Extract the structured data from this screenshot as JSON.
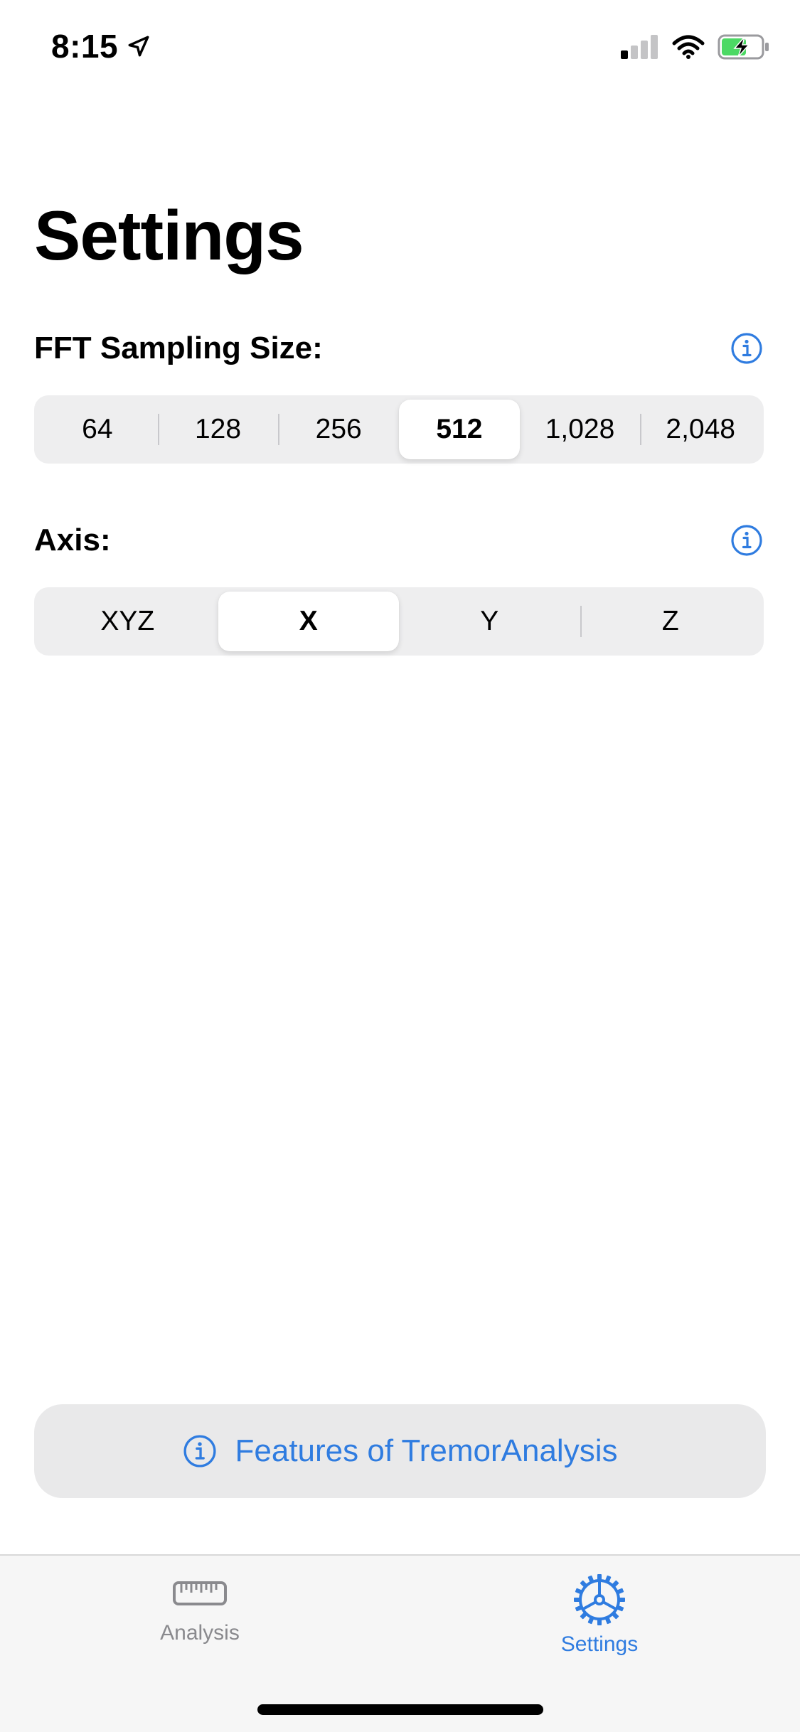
{
  "status_bar": {
    "time": "8:15",
    "location_icon": "location-arrow-icon",
    "signal_icon": "cellular-signal-icon",
    "wifi_icon": "wifi-icon",
    "battery_icon": "battery-charging-icon",
    "battery_color": "#4cd964"
  },
  "page": {
    "title": "Settings"
  },
  "fft_section": {
    "label": "FFT Sampling Size:",
    "info_icon": "info-icon",
    "options": [
      "64",
      "128",
      "256",
      "512",
      "1,028",
      "2,048"
    ],
    "selected": "512"
  },
  "axis_section": {
    "label": "Axis:",
    "info_icon": "info-icon",
    "options": [
      "XYZ",
      "X",
      "Y",
      "Z"
    ],
    "selected": "X"
  },
  "features_button": {
    "label": "Features of TremorAnalysis",
    "icon": "info-icon"
  },
  "tab_bar": {
    "tabs": [
      {
        "label": "Analysis",
        "icon": "ruler-icon",
        "active": false
      },
      {
        "label": "Settings",
        "icon": "gear-icon",
        "active": true
      }
    ]
  },
  "colors": {
    "accent": "#2f7ce0",
    "inactive": "#8a8a8e",
    "segment_bg": "#eeeeef",
    "button_bg": "#e9e9ea"
  }
}
